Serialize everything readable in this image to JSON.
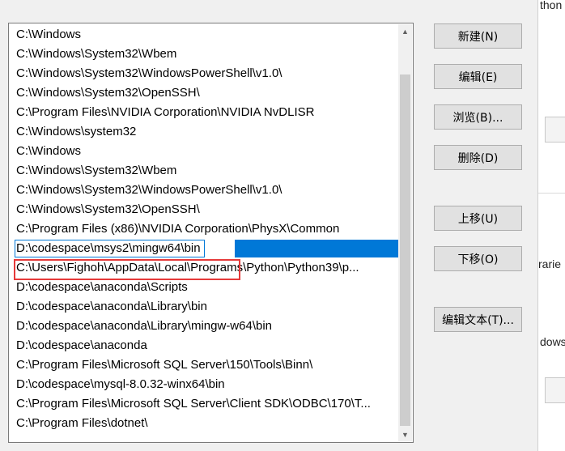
{
  "path_list": {
    "items": [
      "C:\\Windows",
      "C:\\Windows\\System32\\Wbem",
      "C:\\Windows\\System32\\WindowsPowerShell\\v1.0\\",
      "C:\\Windows\\System32\\OpenSSH\\",
      "C:\\Program Files\\NVIDIA Corporation\\NVIDIA NvDLISR",
      "C:\\Windows\\system32",
      "C:\\Windows",
      "C:\\Windows\\System32\\Wbem",
      "C:\\Windows\\System32\\WindowsPowerShell\\v1.0\\",
      "C:\\Windows\\System32\\OpenSSH\\",
      "C:\\Program Files (x86)\\NVIDIA Corporation\\PhysX\\Common",
      "D:\\codespace\\msys2\\mingw64\\bin",
      "C:\\Users\\Fighoh\\AppData\\Local\\Programs\\Python\\Python39\\p...",
      "D:\\codespace\\anaconda\\Scripts",
      "D:\\codespace\\anaconda\\Library\\bin",
      "D:\\codespace\\anaconda\\Library\\mingw-w64\\bin",
      "D:\\codespace\\anaconda",
      "C:\\Program Files\\Microsoft SQL Server\\150\\Tools\\Binn\\",
      "D:\\codespace\\mysql-8.0.32-winx64\\bin",
      "C:\\Program Files\\Microsoft SQL Server\\Client SDK\\ODBC\\170\\T...",
      "C:\\Program Files\\dotnet\\"
    ],
    "selected_index": 11
  },
  "buttons": {
    "new": "新建(N)",
    "edit": "编辑(E)",
    "browse": "浏览(B)...",
    "delete": "删除(D)",
    "move_up": "上移(U)",
    "move_down": "下移(O)",
    "edit_text": "编辑文本(T)..."
  },
  "background_window": {
    "frag1": "thon",
    "frag2": "rarie",
    "frag3": "dows"
  },
  "colors": {
    "selection": "#0078d7",
    "annotation": "#e63a3a"
  }
}
